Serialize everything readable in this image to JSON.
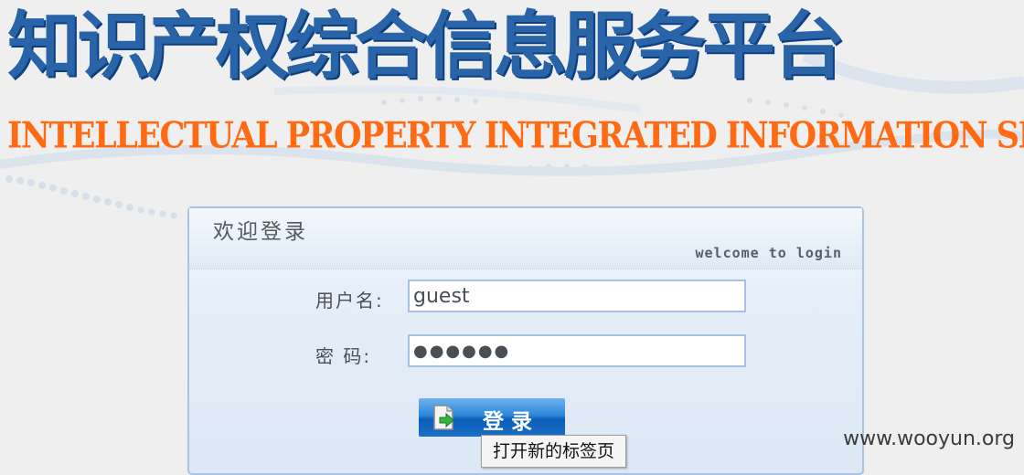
{
  "header": {
    "title_cn": "知识产权综合信息服务平台",
    "title_en": "INTELLECTUAL PROPERTY INTEGRATED INFORMATION SERVI"
  },
  "login": {
    "title": "欢迎登录",
    "subtitle": "welcome to login",
    "username_label": "用户名:",
    "username_value": "guest",
    "password_label": "密 码:",
    "password_value": "●●●●●●",
    "submit_label": "登录"
  },
  "tooltip": "打开新的标签页",
  "watermark": "www.wooyun.org",
  "colors": {
    "title_blue": "#2a64a8",
    "title_orange": "#ff6a13",
    "button_blue": "#1a6fc6",
    "input_border": "#a9c0e6"
  }
}
